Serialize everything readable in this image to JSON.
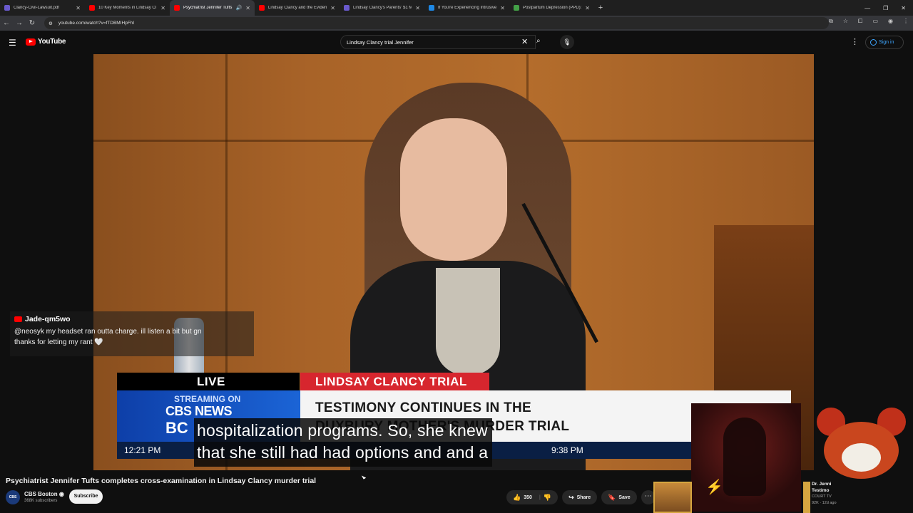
{
  "browser": {
    "tabs": [
      {
        "label": "Clancy-Civil-Lawsuit.pdf",
        "color": "#6a5acd"
      },
      {
        "label": "10 Key Moments in Lindsay Cl",
        "color": "#ff0000"
      },
      {
        "label": "Psychiatrist Jennifer Tufts c",
        "color": "#ff0000"
      },
      {
        "label": "Lindsay Clancy and the Eviden",
        "color": "#ff0000"
      },
      {
        "label": "Lindsay Clancy's Parents' $1 M",
        "color": "#6a5acd"
      },
      {
        "label": "If You're Experiencing Intrusive",
        "color": "#1e88e5"
      },
      {
        "label": "Postpartum Depression (PPD):",
        "color": "#43a047"
      }
    ],
    "url": "youtube.com/watch?v=fTDBMIHpFhI"
  },
  "youtube": {
    "logo": "YouTube",
    "search_query": "Lindsay Clancy trial Jennifer",
    "signin": "Sign in"
  },
  "chat": {
    "username": "Jade-qm5wo",
    "message_line1": "@neosyk my headset ran outta charge. ill listen a bit but gn",
    "message_line2": "thanks for letting my rant 🤍"
  },
  "lower_third": {
    "live": "LIVE",
    "streaming": "STREAMING ON",
    "network": "CBS NEWS",
    "city": "BC",
    "topic": "LINDSAY CLANCY TRIAL",
    "headline_line1": "TESTIMONY CONTINUES IN THE",
    "headline_line2": "DUXBURY MOTHER'S MURDER TRIAL",
    "time_left": "12:21 PM",
    "time_right": "9:38 PM"
  },
  "captions": {
    "line1": "hospitalization programs. So, she knew",
    "line2": "that she still had had options and and a"
  },
  "video": {
    "title": "Psychiatrist Jennifer Tufts completes cross-examination in Lindsay Clancy murder trial",
    "channel": "CBS Boston",
    "subscribers": "368K subscribers",
    "subscribe_label": "Subscribe",
    "likes": "350",
    "share_label": "Share",
    "save_label": "Save"
  },
  "recommended": {
    "title_line1": "Dr. Jenni",
    "title_line2": "Testimo",
    "channel": "COURT TV",
    "meta": "92K · 12d ago"
  }
}
